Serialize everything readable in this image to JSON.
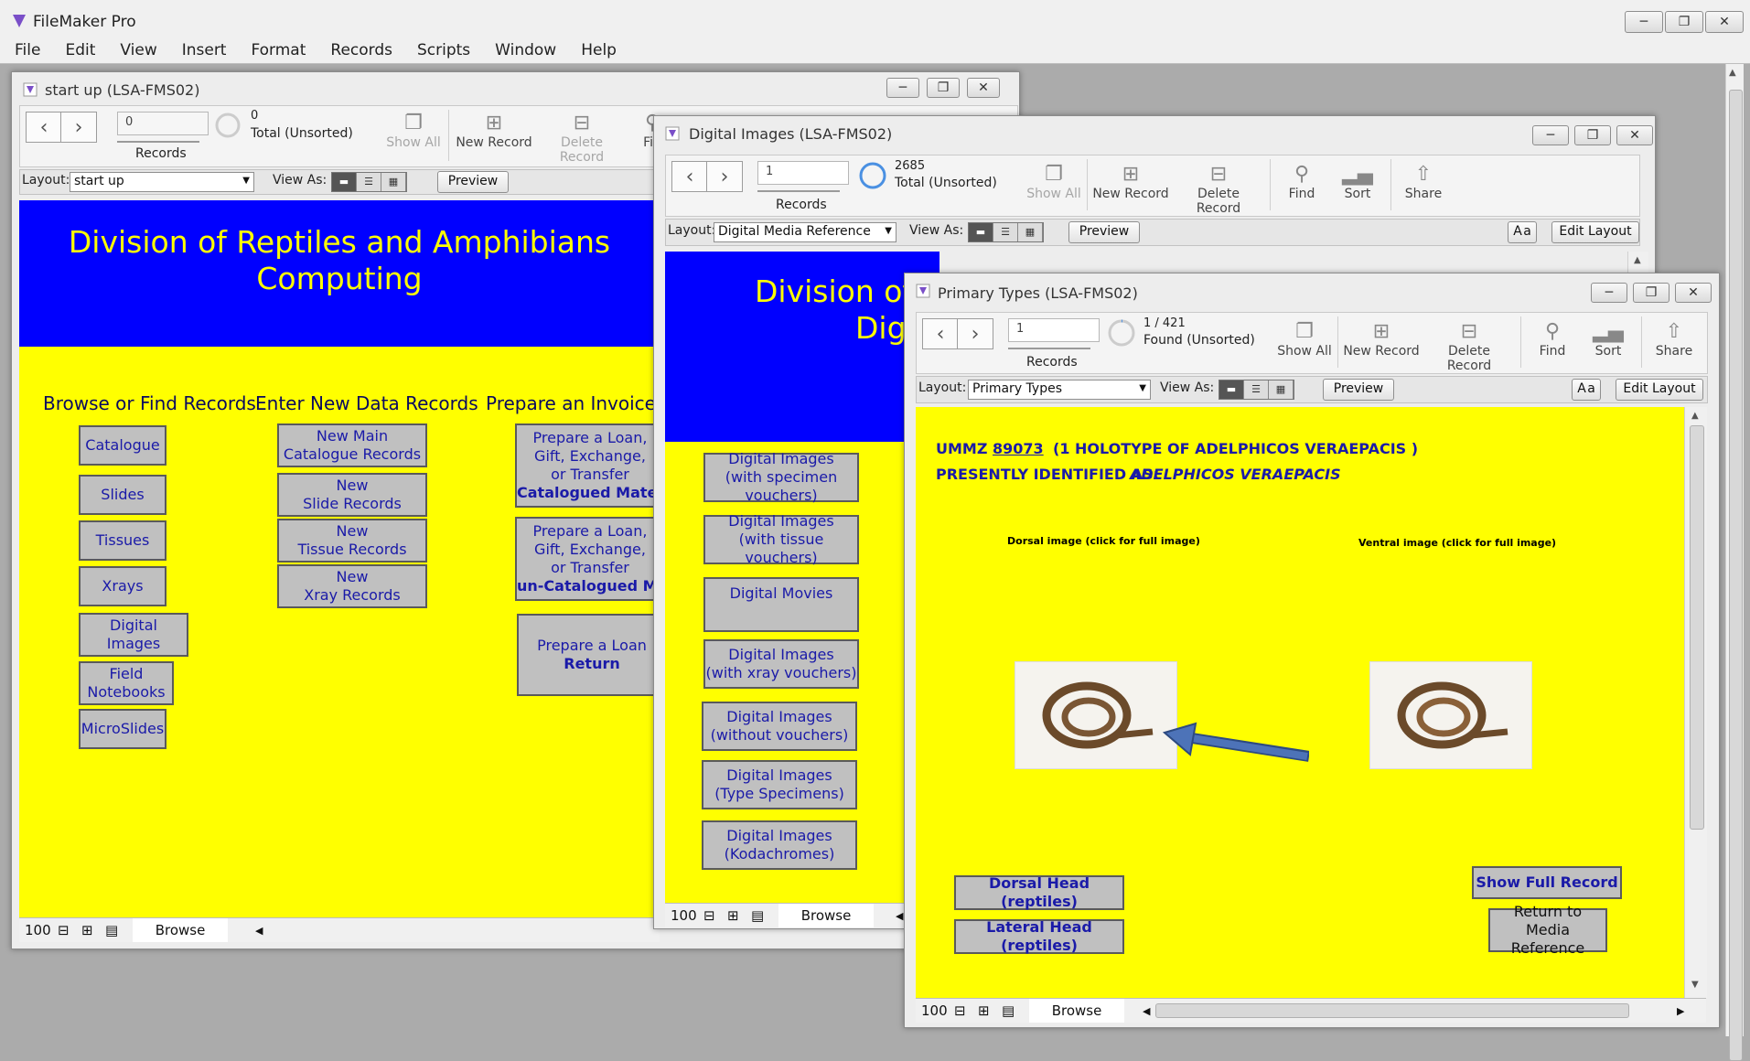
{
  "app": {
    "title": "FileMaker Pro",
    "menu": [
      "File",
      "Edit",
      "View",
      "Insert",
      "Format",
      "Records",
      "Scripts",
      "Window",
      "Help"
    ]
  },
  "win1": {
    "title": "start up (LSA-FMS02)",
    "record_value": "0",
    "record_count": "0",
    "record_status": "Total (Unsorted)",
    "records_label": "Records",
    "tools": {
      "show_all": "Show All",
      "new_record": "New Record",
      "delete_record": "Delete Record",
      "find": "Fin"
    },
    "layout_label": "Layout:",
    "layout_value": "start up",
    "view_as": "View As:",
    "preview": "Preview",
    "header_line1": "Division of Reptiles and Amphibians",
    "header_line2": "Computing",
    "col1_header": "Browse or Find Records",
    "col2_header": "Enter New Data Records",
    "col3_header": "Prepare an Invoice Tra",
    "col1_buttons": [
      "Catalogue",
      "Slides",
      "Tissues",
      "Xrays",
      "Digital Images",
      "Field Notebooks",
      "MicroSlides"
    ],
    "col2_buttons": [
      {
        "l1": "New Main",
        "l2": "Catalogue Records"
      },
      {
        "l1": "New",
        "l2": "Slide Records"
      },
      {
        "l1": "New",
        "l2": "Tissue Records"
      },
      {
        "l1": "New",
        "l2": "Xray Records"
      }
    ],
    "col3_buttons": [
      {
        "l1": "Prepare a Loan,",
        "l2": "Gift, Exchange,",
        "l3": "or Transfer",
        "l4": "Catalogued Mater"
      },
      {
        "l1": "Prepare a Loan,",
        "l2": "Gift, Exchange,",
        "l3": "or Transfer",
        "l4": "un-Catalogued Mat"
      },
      {
        "l1": "Prepare a Loan",
        "l2": "Return"
      }
    ],
    "zoom": "100",
    "mode": "Browse"
  },
  "win2": {
    "title": "Digital Images (LSA-FMS02)",
    "record_value": "1",
    "record_count": "2685",
    "record_status": "Total (Unsorted)",
    "records_label": "Records",
    "tools": {
      "show_all": "Show All",
      "new_record": "New Record",
      "delete_record": "Delete Record",
      "find": "Find",
      "sort": "Sort",
      "share": "Share"
    },
    "layout_label": "Layout:",
    "layout_value": "Digital Media Reference",
    "view_as": "View As:",
    "preview": "Preview",
    "edit_layout": "Edit Layout",
    "header_line1": "Division of",
    "header_line2": "Digit",
    "buttons": [
      {
        "l1": "Digital Images",
        "l2": "(with specimen vouchers)"
      },
      {
        "l1": "Digital Images",
        "l2": "(with tissue vouchers)"
      },
      {
        "l1": "Digital Movies",
        "l2": ""
      },
      {
        "l1": "Digital Images",
        "l2": "(with xray vouchers)"
      },
      {
        "l1": "Digital Images",
        "l2": "(without vouchers)"
      },
      {
        "l1": "Digital Images",
        "l2": "(Type Specimens)"
      },
      {
        "l1": "Digital Images",
        "l2": "(Kodachromes)"
      }
    ],
    "zoom": "100",
    "mode": "Browse"
  },
  "win3": {
    "title": "Primary Types (LSA-FMS02)",
    "record_value": "1",
    "record_count": "1 / 421",
    "record_status": "Found (Unsorted)",
    "records_label": "Records",
    "tools": {
      "show_all": "Show All",
      "new_record": "New Record",
      "delete_record": "Delete Record",
      "find": "Find",
      "sort": "Sort",
      "share": "Share"
    },
    "layout_label": "Layout:",
    "layout_value": "Primary Types",
    "view_as": "View As:",
    "preview": "Preview",
    "edit_layout": "Edit Layout",
    "ummz_prefix": "UMMZ",
    "ummz_number": "89073",
    "holotype": "(1 HOLOTYPE OF ADELPHICOS VERAEPACIS )",
    "identified_label": "PRESENTLY IDENTIFIED AS:",
    "identified_value": "ADELPHICOS VERAEPACIS",
    "dorsal_caption": "Dorsal image (click for full image)",
    "ventral_caption": "Ventral image (click for full image)",
    "btn_dorsal_head": "Dorsal Head (reptiles)",
    "btn_lateral_head": "Lateral Head (reptiles)",
    "btn_show_full": "Show Full Record",
    "btn_return_l1": "Return to Media",
    "btn_return_l2": "Reference",
    "zoom": "100",
    "mode": "Browse",
    "arrow_color": "#3e5f9c"
  },
  "colors": {
    "header_blue": "#0000ff",
    "body_yellow": "#ffff00",
    "title_yellow": "#ffff00",
    "button_text": "#1a1aa8"
  }
}
